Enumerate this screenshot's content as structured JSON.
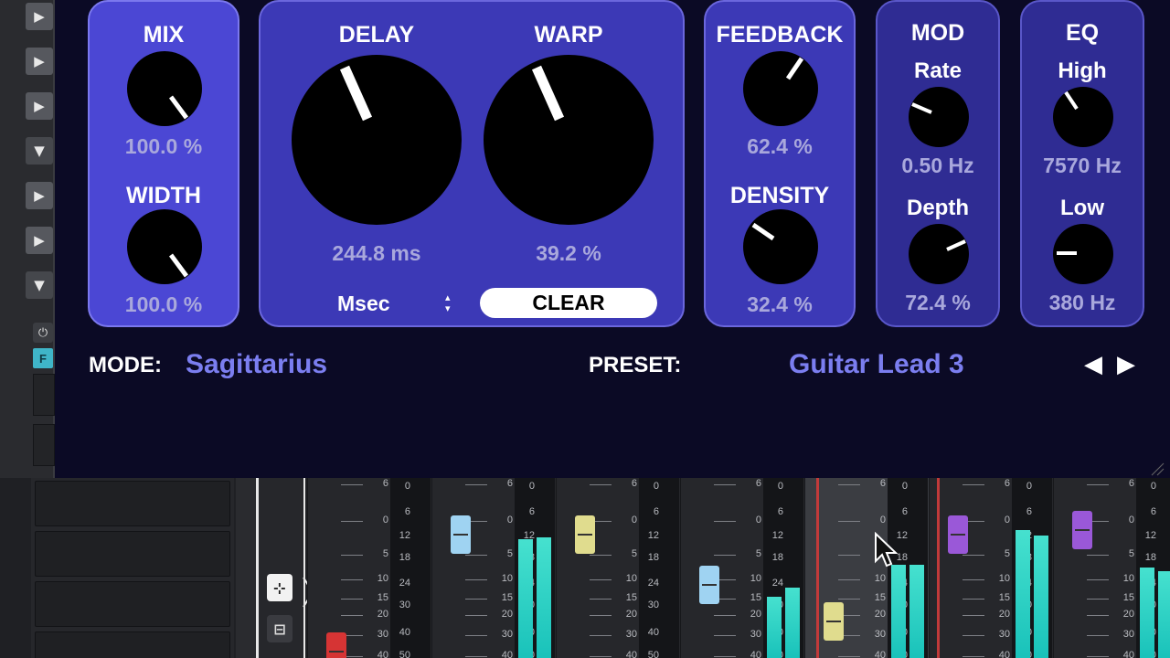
{
  "left_strip": {
    "buttons": [
      "▶",
      "▶",
      "▶",
      "▼",
      "▶",
      "▶",
      "▶",
      "▼"
    ],
    "power_glyph": "⏻",
    "f_label": "F"
  },
  "plugin": {
    "mix": {
      "label": "MIX",
      "value": "100.0 %"
    },
    "width": {
      "label": "WIDTH",
      "value": "100.0 %"
    },
    "delay": {
      "label": "DELAY",
      "value": "244.8 ms"
    },
    "warp": {
      "label": "WARP",
      "value": "39.2 %"
    },
    "time_mode": {
      "label": "Msec",
      "arrows": "▴▾"
    },
    "clear_button": "CLEAR",
    "feedback": {
      "label": "FEEDBACK",
      "value": "62.4 %"
    },
    "density": {
      "label": "DENSITY",
      "value": "32.4 %"
    },
    "mod": {
      "title": "MOD",
      "rate_label": "Rate",
      "rate_value": "0.50 Hz",
      "depth_label": "Depth",
      "depth_value": "72.4 %"
    },
    "eq": {
      "title": "EQ",
      "high_label": "High",
      "high_value": "7570 Hz",
      "low_label": "Low",
      "low_value": "380 Hz"
    },
    "mode_label": "MODE:",
    "mode_value": "Sagittarius",
    "preset_label": "PRESET:",
    "preset_value": "Guitar Lead 3",
    "preset_prev": "◀",
    "preset_next": "▶"
  },
  "mixer": {
    "scale_a": [
      "6",
      "0",
      "5",
      "10",
      "15",
      "20",
      "30",
      "40"
    ],
    "scale_b": [
      "0",
      "6",
      "12",
      "18",
      "24",
      "30",
      "40",
      "50"
    ],
    "channels": [
      {
        "fader_color": "#d63434",
        "fader_level": 0.02,
        "meter_levels": [
          0,
          0
        ]
      },
      {
        "fader_color": "#9fd3f2",
        "fader_level": 0.72,
        "meter_levels": [
          0.66,
          0.67
        ]
      },
      {
        "fader_color": "#e0dc8e",
        "fader_level": 0.72,
        "meter_levels": [
          0,
          0
        ]
      },
      {
        "fader_color": "#9fd3f2",
        "fader_level": 0.42,
        "meter_levels": [
          0.34,
          0.39
        ]
      },
      {
        "fader_color": "#e0dc8e",
        "fader_level": 0.2,
        "meter_levels": [
          0.52,
          0.52
        ]
      },
      {
        "fader_color": "#9a58d8",
        "fader_level": 0.72,
        "meter_levels": [
          0.71,
          0.68
        ]
      },
      {
        "fader_color": "#9a58d8",
        "fader_level": 0.75,
        "meter_levels": [
          0.5,
          0.48
        ]
      }
    ],
    "tool_icons": [
      "⊹",
      "⊟"
    ]
  }
}
